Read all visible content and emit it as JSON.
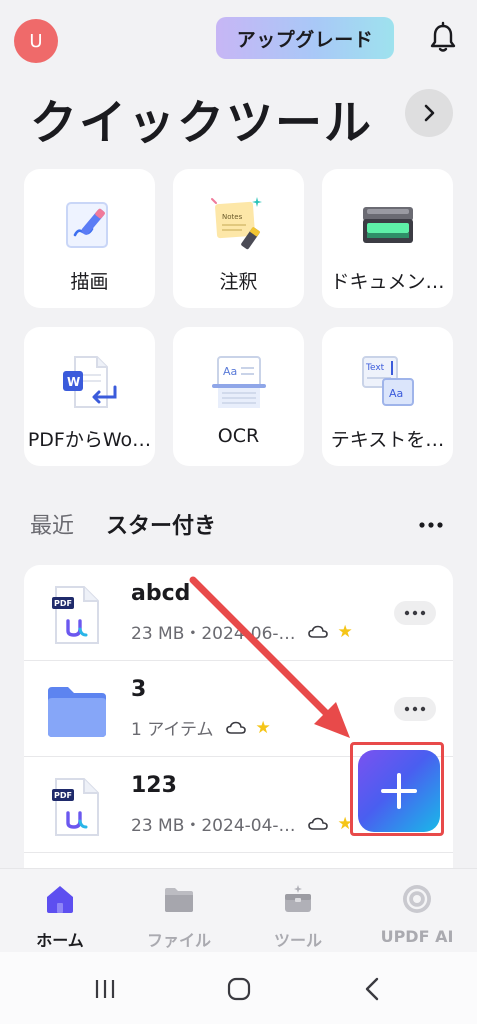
{
  "header": {
    "avatar_initial": "U",
    "upgrade_label": "アップグレード",
    "bell_icon": "bell-icon"
  },
  "quick_tools": {
    "title": "クイックツール",
    "tiles": [
      {
        "label": "描画",
        "icon": "drawing-icon"
      },
      {
        "label": "注釈",
        "icon": "notes-annotation-icon"
      },
      {
        "label": "ドキュメン…",
        "icon": "scanner-icon"
      },
      {
        "label": "PDFからWo…",
        "icon": "pdf-to-word-icon"
      },
      {
        "label": "OCR",
        "icon": "ocr-icon"
      },
      {
        "label": "テキストを…",
        "icon": "text-recognition-icon"
      }
    ]
  },
  "tabs": {
    "recent": "最近",
    "starred": "スター付き"
  },
  "files": [
    {
      "name": "abcd",
      "meta": "23 MB・2024-06-…",
      "type": "pdf",
      "starred": true
    },
    {
      "name": "3",
      "meta": "1 アイテム",
      "type": "folder",
      "starred": true
    },
    {
      "name": "123",
      "meta": "23 MB・2024-04-…",
      "type": "pdf",
      "starred": true
    }
  ],
  "fab": {
    "icon": "plus-icon"
  },
  "bottom_nav": [
    {
      "label": "ホーム",
      "icon": "home-icon",
      "active": true
    },
    {
      "label": "ファイル",
      "icon": "folder-icon",
      "active": false
    },
    {
      "label": "ツール",
      "icon": "toolbox-icon",
      "active": false
    },
    {
      "label": "UPDF AI",
      "icon": "ai-icon",
      "active": false
    }
  ],
  "colors": {
    "accent": "#5a4cf0",
    "annotation_red": "#e84a4a",
    "star": "#f5c518",
    "avatar": "#ef6a6a"
  }
}
